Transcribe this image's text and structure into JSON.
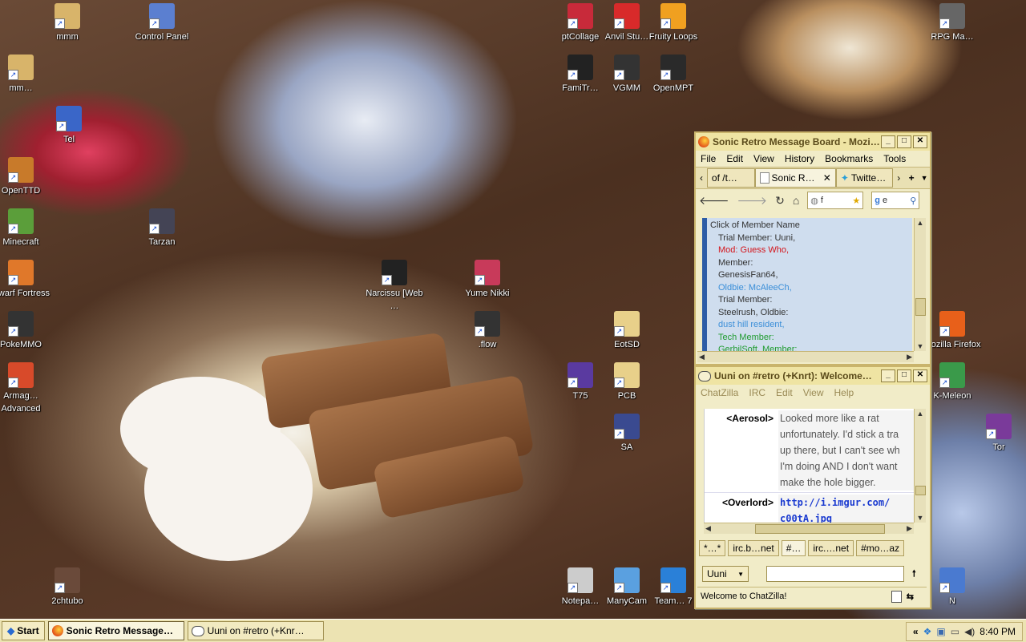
{
  "desktop_icons": [
    {
      "label": "mmm",
      "icon": "folder-icon"
    },
    {
      "label": "Control Panel",
      "icon": "control-panel-icon"
    },
    {
      "label": "mm…",
      "icon": "folder-icon"
    },
    {
      "label": "Tel",
      "icon": "help-icon"
    },
    {
      "label": "OpenTTD",
      "icon": "openttd-icon"
    },
    {
      "label": "Minecraft",
      "icon": "minecraft-icon"
    },
    {
      "label": "Tarzan",
      "icon": "tarzan-icon"
    },
    {
      "label": "Dwarf Fortress",
      "icon": "dwarf-fortress-icon"
    },
    {
      "label": "PokeMMO",
      "icon": "pokemmo-icon"
    },
    {
      "label": "Armag… Advanced",
      "icon": "armagetron-icon"
    },
    {
      "label": "2chtubo",
      "icon": "2chtubo-icon"
    },
    {
      "label": "Narcissu [Web …",
      "icon": "narcissu-icon"
    },
    {
      "label": "Yume Nikki",
      "icon": "yume-nikki-icon"
    },
    {
      "label": ".flow",
      "icon": "flow-icon"
    },
    {
      "label": "ptCollage",
      "icon": "ptcollage-icon"
    },
    {
      "label": "Anvil Stu…",
      "icon": "anvil-studio-icon"
    },
    {
      "label": "Fruity Loops",
      "icon": "fruity-loops-icon"
    },
    {
      "label": "FamiTr…",
      "icon": "famitracker-icon"
    },
    {
      "label": "VGMM",
      "icon": "vgmm-icon"
    },
    {
      "label": "OpenMPT",
      "icon": "openmpt-icon"
    },
    {
      "label": "EotSD",
      "icon": "eotsd-icon"
    },
    {
      "label": "T75",
      "icon": "t75-icon"
    },
    {
      "label": "PCB",
      "icon": "pcb-icon"
    },
    {
      "label": "SA",
      "icon": "sa-icon"
    },
    {
      "label": "Notepa…",
      "icon": "notepad-icon"
    },
    {
      "label": "ManyCam",
      "icon": "manycam-icon"
    },
    {
      "label": "Team… 7",
      "icon": "teamviewer-icon"
    },
    {
      "label": "RPG Ma…",
      "icon": "rpg-maker-icon"
    },
    {
      "label": "Mozilla Firefox",
      "icon": "firefox-icon"
    },
    {
      "label": "K-Meleon",
      "icon": "k-meleon-icon"
    },
    {
      "label": "Tor",
      "icon": "tor-icon"
    },
    {
      "label": "N",
      "icon": "n-icon"
    }
  ],
  "firefox": {
    "title": "Sonic Retro Message Board - Mozi…",
    "menu": [
      "File",
      "Edit",
      "View",
      "History",
      "Bookmarks",
      "Tools"
    ],
    "tabs": [
      "of /t…",
      "Sonic R…",
      "Twitte…"
    ],
    "url_text": "f",
    "search_text": "e",
    "content_lines": [
      {
        "text": "Click of Member Name",
        "color": "#333333",
        "indent": false
      },
      {
        "text": "Trial Member: Uuni,",
        "color": "#333333",
        "indent": true
      },
      {
        "text": "Mod: Guess Who,",
        "color": "#d4141a",
        "indent": true
      },
      {
        "text": "Member:",
        "color": "#333333",
        "indent": true
      },
      {
        "text": "GenesisFan64,",
        "color": "#333333",
        "indent": true
      },
      {
        "text": "Oldbie: McAleeCh,",
        "color": "#3a8ed8",
        "indent": true
      },
      {
        "text": "Trial Member:",
        "color": "#333333",
        "indent": true
      },
      {
        "text": "Steelrush, Oldbie:",
        "color": "#333333",
        "indent": true
      },
      {
        "text": "dust hill resident,",
        "color": "#3a8ed8",
        "indent": true
      },
      {
        "text": "Tech Member:",
        "color": "#1f9b2f",
        "indent": true
      },
      {
        "text": "GerbilSoft, Member:",
        "color": "#1f9b2f",
        "indent": true
      }
    ]
  },
  "chatzilla": {
    "title": "Uuni on #retro (+Knrt): Welcome…",
    "menu": [
      "ChatZilla",
      "IRC",
      "Edit",
      "View",
      "Help"
    ],
    "messages": [
      {
        "nick": "<Aerosol>",
        "lines": [
          "Looked more like a rat",
          "unfortunately. I'd stick a tra",
          "up there, but I can't see wh",
          "I'm doing AND I don't want",
          "make the hole bigger."
        ],
        "link": false
      },
      {
        "nick": "<Overlord>",
        "lines": [
          "http://i.imgur.com/",
          "c00tA.jpg"
        ],
        "link": true
      }
    ],
    "channel_tabs": [
      "*…*",
      "irc.b…net",
      "#…",
      "irc.…net",
      "#mo…az"
    ],
    "nick_button": "Uuni",
    "input_value": "",
    "status": "Welcome to ChatZilla!"
  },
  "taskbar": {
    "start_label": "Start",
    "buttons": [
      "Sonic Retro Message…",
      "Uuni on #retro (+Knr…"
    ],
    "time": "8:40 PM",
    "tray_chevron": "«"
  }
}
